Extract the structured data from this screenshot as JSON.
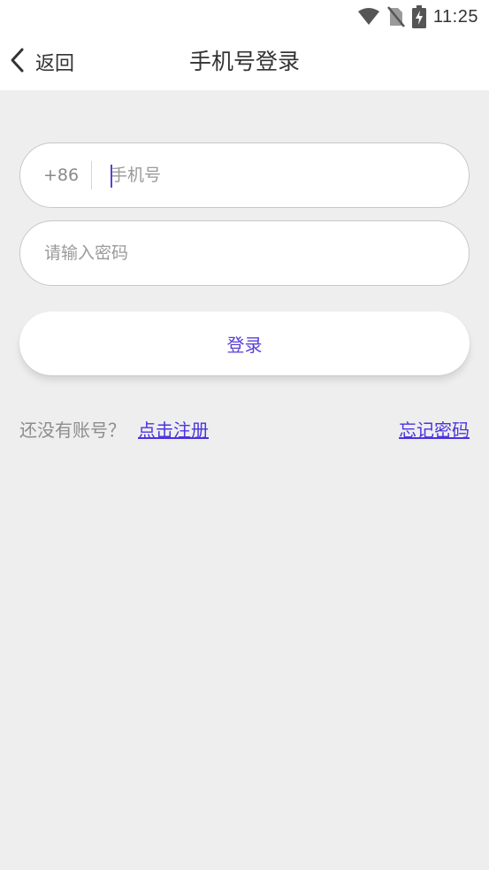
{
  "status_bar": {
    "time": "11:25",
    "icons": [
      "wifi-icon",
      "no-sim-icon",
      "battery-charging-icon"
    ]
  },
  "nav": {
    "back_label": "返回",
    "title": "手机号登录"
  },
  "form": {
    "country_code": "+86",
    "phone_placeholder": "手机号",
    "phone_value": "",
    "password_placeholder": "请输入密码",
    "password_value": "",
    "login_label": "登录"
  },
  "footer": {
    "no_account_text": "还没有账号？",
    "register_label": "点击注册",
    "forgot_label": "忘记密码"
  },
  "colors": {
    "accent": "#5a3fd8",
    "link": "#4a33e0",
    "background": "#eeeeee"
  }
}
